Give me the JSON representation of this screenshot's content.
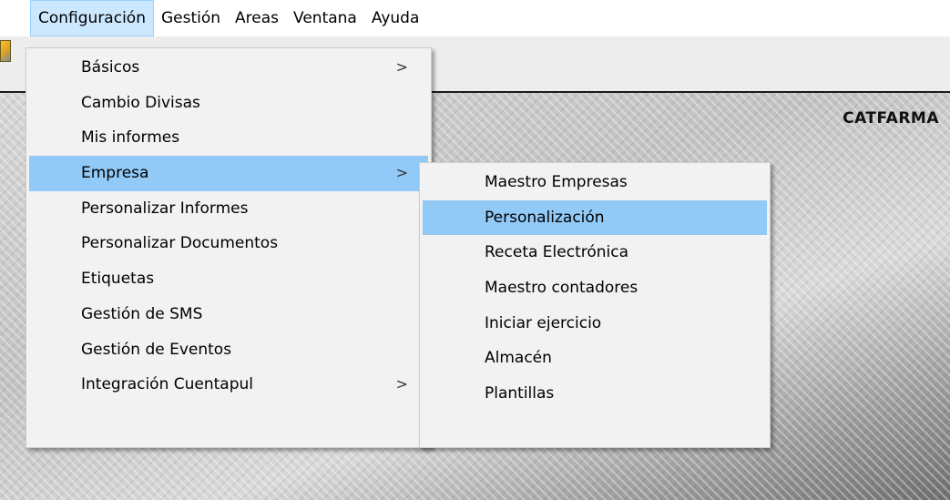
{
  "menubar": {
    "items": [
      "Configuración",
      "Gestión",
      "Areas",
      "Ventana",
      "Ayuda"
    ],
    "active": "Configuración"
  },
  "company_label": "CATFARMA",
  "config_menu": {
    "items": [
      {
        "label": "Básicos",
        "submenu": true
      },
      {
        "label": "Cambio Divisas",
        "submenu": false
      },
      {
        "label": "Mis informes",
        "submenu": false
      },
      {
        "label": "Empresa",
        "submenu": true,
        "highlighted": true
      },
      {
        "label": "Personalizar Informes",
        "submenu": false
      },
      {
        "label": "Personalizar Documentos",
        "submenu": false
      },
      {
        "label": "Etiquetas",
        "submenu": false
      },
      {
        "label": "Gestión de SMS",
        "submenu": false
      },
      {
        "label": "Gestión de Eventos",
        "submenu": false
      },
      {
        "label": "Integración Cuentapul",
        "submenu": true
      }
    ],
    "arrow_glyph": ">"
  },
  "empresa_submenu": {
    "items": [
      {
        "label": "Maestro Empresas"
      },
      {
        "label": "Personalización",
        "highlighted": true
      },
      {
        "label": "Receta Electrónica"
      },
      {
        "label": "Maestro contadores"
      },
      {
        "label": "Iniciar ejercicio"
      },
      {
        "label": "Almacén"
      },
      {
        "label": "Plantillas"
      }
    ]
  },
  "colors": {
    "highlight": "#91c9f7",
    "menubar_active": "#cce8ff",
    "menu_bg": "#f2f2f2"
  }
}
